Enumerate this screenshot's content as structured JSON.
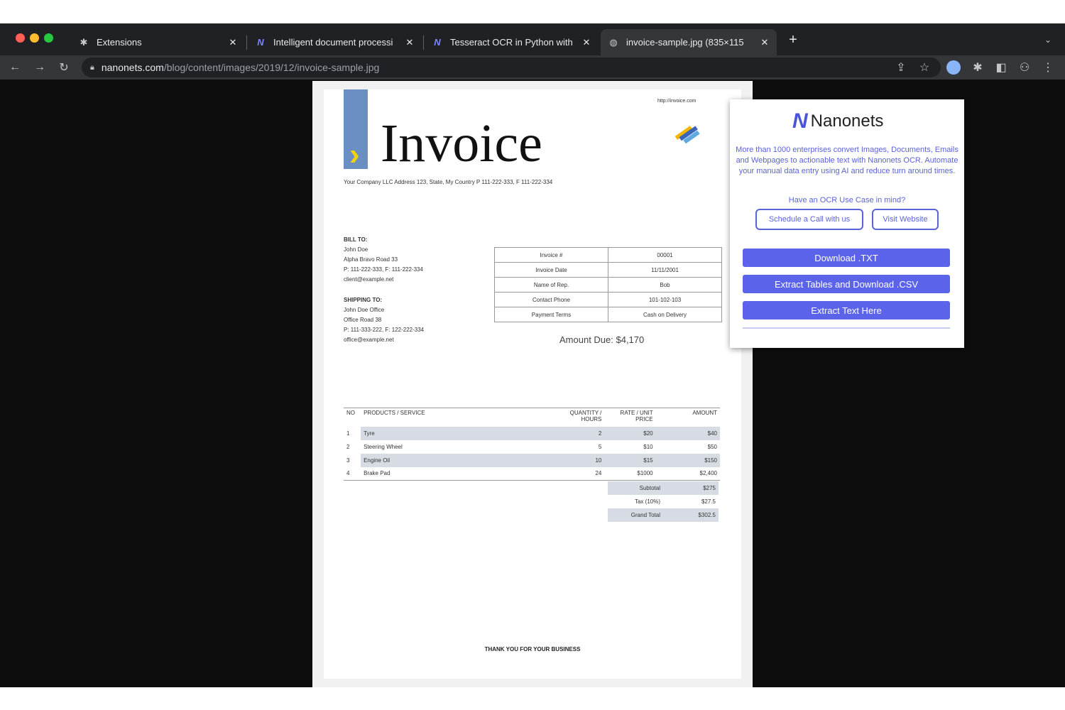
{
  "tabs": [
    {
      "title": "Extensions",
      "icon": "puzzle-icon"
    },
    {
      "title": "Intelligent document processi",
      "icon": "nanonets-icon"
    },
    {
      "title": "Tesseract OCR in Python with",
      "icon": "nanonets-icon"
    },
    {
      "title": "invoice-sample.jpg (835×115",
      "icon": "globe-icon"
    }
  ],
  "new_tab_label": "+",
  "address": {
    "host": "nanonets.com",
    "path": "/blog/content/images/2019/12/invoice-sample.jpg"
  },
  "invoice": {
    "url": "http://invoice.com",
    "title": "Invoice",
    "company_line": "Your Company LLC Address 123, State, My Country P 111-222-333, F 111-222-334",
    "bill_to_label": "BILL TO:",
    "bill_to": [
      "John Doe",
      "Alpha Bravo Road 33",
      "P: 111-222-333, F: 111-222-334",
      "client@example.net"
    ],
    "ship_to_label": "SHIPPING TO:",
    "ship_to": [
      "John Doe Office",
      "Office Road 38",
      "P: 111-333-222, F: 122-222-334",
      "office@example.net"
    ],
    "details": [
      {
        "label": "Invoice #",
        "value": "00001"
      },
      {
        "label": "Invoice Date",
        "value": "11/11/2001"
      },
      {
        "label": "Name of Rep.",
        "value": "Bob"
      },
      {
        "label": "Contact Phone",
        "value": "101-102-103"
      },
      {
        "label": "Payment Terms",
        "value": "Cash on Delivery"
      }
    ],
    "amount_due": "Amount Due: $4,170",
    "columns": [
      "NO",
      "PRODUCTS / SERVICE",
      "QUANTITY / HOURS",
      "RATE / UNIT PRICE",
      "AMOUNT"
    ],
    "items": [
      {
        "no": "1",
        "product": "Tyre",
        "qty": "2",
        "rate": "$20",
        "amount": "$40"
      },
      {
        "no": "2",
        "product": "Steering Wheel",
        "qty": "5",
        "rate": "$10",
        "amount": "$50"
      },
      {
        "no": "3",
        "product": "Engine Oil",
        "qty": "10",
        "rate": "$15",
        "amount": "$150"
      },
      {
        "no": "4",
        "product": "Brake Pad",
        "qty": "24",
        "rate": "$1000",
        "amount": "$2,400"
      }
    ],
    "totals": [
      {
        "label": "Subtotal",
        "value": "$275"
      },
      {
        "label": "Tax (10%)",
        "value": "$27.5"
      },
      {
        "label": "Grand Total",
        "value": "$302.5"
      }
    ],
    "thanks": "THANK YOU FOR YOUR BUSINESS"
  },
  "popup": {
    "brand": "Nanonets",
    "description": "More than 1000 enterprises convert Images, Documents, Emails and Webpages to actionable text with Nanonets OCR. Automate your manual data entry using AI and reduce turn around times.",
    "question": "Have an OCR Use Case in mind?",
    "schedule_label": "Schedule a Call with us",
    "visit_label": "Visit Website",
    "download_txt": "Download .TXT",
    "extract_csv": "Extract Tables and Download .CSV",
    "extract_text": "Extract Text Here"
  },
  "colors": {
    "accent": "#5b63ea",
    "tab_bg": "#202124",
    "toolbar_bg": "#35363a",
    "invoice_bar": "#6b8fc2",
    "invoice_chevron": "#f2d200"
  }
}
